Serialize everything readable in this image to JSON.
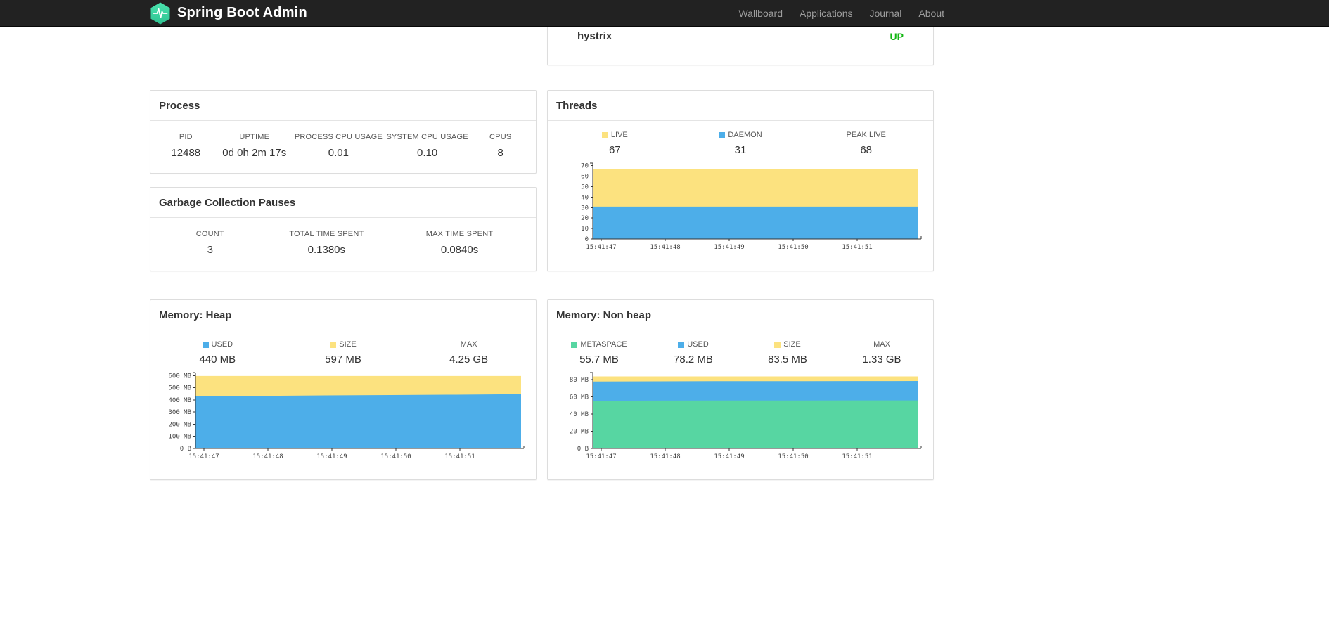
{
  "navbar": {
    "brand": "Spring Boot Admin",
    "links": [
      {
        "label": "Wallboard"
      },
      {
        "label": "Applications"
      },
      {
        "label": "Journal"
      },
      {
        "label": "About"
      }
    ]
  },
  "applications_panel": {
    "row": {
      "name": "hystrix",
      "status": "UP",
      "status_color": "#13b713"
    }
  },
  "process": {
    "title": "Process",
    "metrics": [
      {
        "label": "PID",
        "value": "12488"
      },
      {
        "label": "UPTIME",
        "value": "0d 0h 2m 17s"
      },
      {
        "label": "PROCESS CPU USAGE",
        "value": "0.01"
      },
      {
        "label": "SYSTEM CPU USAGE",
        "value": "0.10"
      },
      {
        "label": "CPUS",
        "value": "8"
      }
    ]
  },
  "gc": {
    "title": "Garbage Collection Pauses",
    "metrics": [
      {
        "label": "COUNT",
        "value": "3"
      },
      {
        "label": "TOTAL TIME SPENT",
        "value": "0.1380s"
      },
      {
        "label": "MAX TIME SPENT",
        "value": "0.0840s"
      }
    ]
  },
  "threads": {
    "title": "Threads",
    "legend": [
      {
        "label": "LIVE",
        "value": "67",
        "color": "#fce27f"
      },
      {
        "label": "DAEMON",
        "value": "31",
        "color": "#4daee9"
      },
      {
        "label": "PEAK LIVE",
        "value": "68",
        "color": null
      }
    ]
  },
  "heap": {
    "title": "Memory: Heap",
    "legend": [
      {
        "label": "USED",
        "value": "440 MB",
        "color": "#4daee9"
      },
      {
        "label": "SIZE",
        "value": "597 MB",
        "color": "#fce27f"
      },
      {
        "label": "MAX",
        "value": "4.25 GB",
        "color": null
      }
    ]
  },
  "nonheap": {
    "title": "Memory: Non heap",
    "legend": [
      {
        "label": "METASPACE",
        "value": "55.7 MB",
        "color": "#57d6a2"
      },
      {
        "label": "USED",
        "value": "78.2 MB",
        "color": "#4daee9"
      },
      {
        "label": "SIZE",
        "value": "83.5 MB",
        "color": "#fce27f"
      },
      {
        "label": "MAX",
        "value": "1.33 GB",
        "color": null
      }
    ]
  },
  "chart_data": [
    {
      "id": "threads",
      "type": "area",
      "title": "Threads",
      "x": [
        "15:41:47",
        "15:41:48",
        "15:41:49",
        "15:41:50",
        "15:41:51"
      ],
      "ylim": [
        0,
        72.5
      ],
      "yticks": [
        {
          "v": 0,
          "l": "0"
        },
        {
          "v": 10,
          "l": "10"
        },
        {
          "v": 20,
          "l": "20"
        },
        {
          "v": 30,
          "l": "30"
        },
        {
          "v": 40,
          "l": "40"
        },
        {
          "v": 50,
          "l": "50"
        },
        {
          "v": 60,
          "l": "60"
        },
        {
          "v": 70,
          "l": "70"
        }
      ],
      "series": [
        {
          "name": "LIVE",
          "color": "#fce27f",
          "values": [
            67,
            67,
            67,
            67,
            67,
            67
          ]
        },
        {
          "name": "DAEMON",
          "color": "#4daee9",
          "values": [
            31,
            31,
            31,
            31,
            31,
            31
          ]
        }
      ]
    },
    {
      "id": "memory-heap",
      "type": "area",
      "title": "Memory: Heap",
      "x": [
        "15:41:47",
        "15:41:48",
        "15:41:49",
        "15:41:50",
        "15:41:51"
      ],
      "ylim": [
        0,
        625
      ],
      "yticks": [
        {
          "v": 0,
          "l": "0 B"
        },
        {
          "v": 100,
          "l": "100 MB"
        },
        {
          "v": 200,
          "l": "200 MB"
        },
        {
          "v": 300,
          "l": "300 MB"
        },
        {
          "v": 400,
          "l": "400 MB"
        },
        {
          "v": 500,
          "l": "500 MB"
        },
        {
          "v": 600,
          "l": "600 MB"
        }
      ],
      "series": [
        {
          "name": "SIZE",
          "color": "#fce27f",
          "values": [
            597,
            597,
            597,
            597,
            597,
            597
          ]
        },
        {
          "name": "USED",
          "color": "#4daee9",
          "values": [
            430,
            433,
            437,
            440,
            443,
            447
          ]
        }
      ]
    },
    {
      "id": "memory-nonheap",
      "type": "area",
      "title": "Memory: Non heap",
      "x": [
        "15:41:47",
        "15:41:48",
        "15:41:49",
        "15:41:50",
        "15:41:51"
      ],
      "ylim": [
        0,
        88
      ],
      "yticks": [
        {
          "v": 0,
          "l": "0 B"
        },
        {
          "v": 20,
          "l": "20 MB"
        },
        {
          "v": 40,
          "l": "40 MB"
        },
        {
          "v": 60,
          "l": "60 MB"
        },
        {
          "v": 80,
          "l": "80 MB"
        }
      ],
      "series": [
        {
          "name": "SIZE",
          "color": "#fce27f",
          "values": [
            83.5,
            83.5,
            83.5,
            83.5,
            83.5,
            83.5
          ]
        },
        {
          "name": "USED",
          "color": "#4daee9",
          "values": [
            77.6,
            77.8,
            78.0,
            78.0,
            78.1,
            78.2
          ]
        },
        {
          "name": "METASPACE",
          "color": "#57d6a2",
          "values": [
            55.4,
            55.5,
            55.6,
            55.6,
            55.7,
            55.7
          ]
        }
      ]
    }
  ]
}
